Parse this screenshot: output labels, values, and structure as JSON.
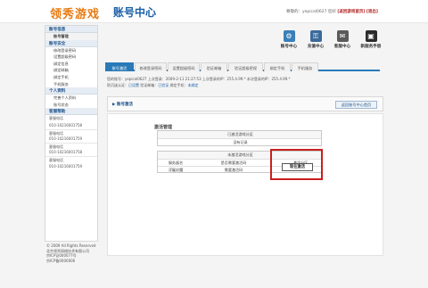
{
  "header": {
    "logo": "领秀游戏",
    "site_title": "账号中心",
    "welcome": "尊敬的：yepical0627 您好",
    "link_to_home": "[返回游戏首页]",
    "link_logout": "[退出]"
  },
  "sidebar": {
    "account_info": {
      "title": "账号信息",
      "items": [
        "账号管理"
      ]
    },
    "account_security": {
      "title": "账号安全",
      "items": [
        "修改登录密码",
        "设置超级密码",
        "绑定信息",
        "绑定邮箱",
        "绑定手机",
        "手机服务"
      ]
    },
    "personal": {
      "title": "个人资料",
      "items": [
        "完善个人资料",
        "账号状态"
      ]
    },
    "service": {
      "title": "客服帮助",
      "lines": [
        "客服电话",
        "010-10216001758",
        "客服电话",
        "010-10216001759",
        "客服电话",
        "010-10216001758",
        "客服电话",
        "010-10216001759"
      ]
    }
  },
  "footer": {
    "lines": [
      "© 2009 All Rights Reserved",
      "北京领秀网络技术有限公司",
      "京ICP证000077号",
      "京ICP备0000006"
    ]
  },
  "icons": [
    {
      "name": "account-center-icon",
      "label": "账号中心",
      "glyph": "⚙",
      "color": "#3a7fb8"
    },
    {
      "name": "recharge-center-icon",
      "label": "充值中心",
      "glyph": "⚿",
      "color": "#3a6a9a"
    },
    {
      "name": "service-center-icon",
      "label": "客服中心",
      "glyph": "✉",
      "color": "#5a5a5a"
    },
    {
      "name": "newbie-guide-icon",
      "label": "新服务手册",
      "glyph": "▣",
      "color": "#2b2b2b"
    }
  ],
  "tabs": [
    "账号激活",
    "修改登录密码",
    "设置超级密码",
    "验证邮箱",
    "验证超级密保",
    "绑定手机",
    "手机服务"
  ],
  "info": {
    "line1": "您的账号：yepical0627  上次登录：2009-2-11 21:27:53  上次登录的IP：255.4.99.*  本次登录的IP：255.4.99.*",
    "line2_a": "防沉迷认证：",
    "line2_b": "已设置",
    "line2_c": "  验证邮箱：",
    "line2_d": "已验证",
    "line2_e": "  绑定手机：",
    "line2_f": "未绑定"
  },
  "section": {
    "title": "账号激活",
    "button": "返回账号中心首页"
  },
  "activation": {
    "heading": "激活管理",
    "activated_header": "已激活游戏分区",
    "activated_empty": "没有记录",
    "unactivated_header": "未激活游戏分区",
    "columns": [
      "服务器名",
      "是否需要激活码",
      "激活分区"
    ],
    "rows": [
      {
        "server": "浮屠封魔",
        "need_code": "需要激活码",
        "action": "现在激活"
      }
    ]
  }
}
